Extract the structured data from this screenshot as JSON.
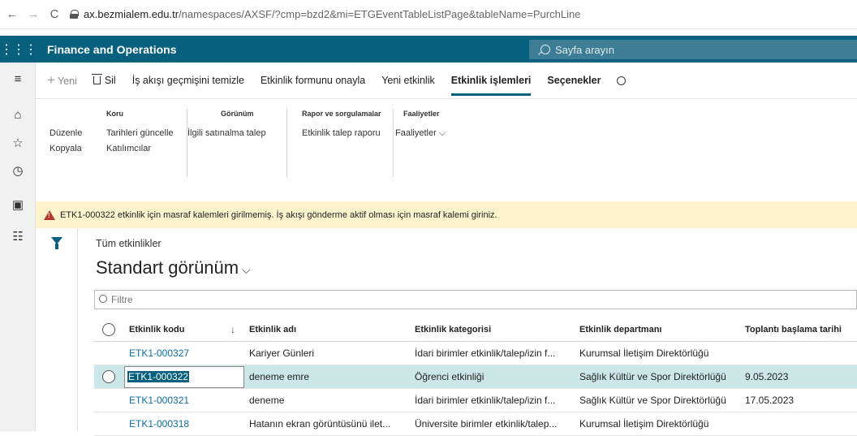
{
  "browser": {
    "back": "←",
    "forward": "→",
    "reload": "C",
    "url_host": "ax.bezmialem.edu.tr",
    "url_path": "/namespaces/AXSF/?cmp=bzd2&mi=ETGEventTableListPage&tableName=PurchLine"
  },
  "app": {
    "waffle": "⋮⋮⋮",
    "title": "Finance and Operations",
    "search_placeholder": "Sayfa arayın"
  },
  "leftnav": {
    "items": [
      "hamburger-icon",
      "home-icon",
      "star-icon",
      "clock-icon",
      "workspace-icon",
      "list-icon"
    ]
  },
  "actions": {
    "new": "Yeni",
    "delete": "Sil",
    "clear_history": "İş akışı geçmişini temizle",
    "confirm_form": "Etkinlik formunu onayla",
    "new_event": "Yeni etkinlik",
    "event_ops": "Etkinlik işlemleri",
    "options": "Seçenekler"
  },
  "ribbon": {
    "edit": "Düzenle",
    "copy": "Kopyala",
    "koru_title": "Koru",
    "update_dates": "Tarihleri güncelle",
    "participants": "Katılımcılar",
    "view_title": "Görünüm",
    "related_purchase": "İlgili satınalma talep",
    "reports_title": "Rapor ve sorgulamalar",
    "event_request_report": "Etkinlik talep raporu",
    "activities_title": "Faaliyetler",
    "activities": "Faaliyetler"
  },
  "warning": {
    "text": "ETK1-000322 etkinlik için masraf kalemleri girilmemiş. İş akışı gönderme aktif olması için masraf kalemi giriniz."
  },
  "list": {
    "crumb": "Tüm etkinlikler",
    "view_title": "Standart görünüm",
    "filter_placeholder": "Filtre",
    "columns": {
      "code": "Etkinlik kodu",
      "name": "Etkinlik adı",
      "category": "Etkinlik kategorisi",
      "department": "Etkinlik departmanı",
      "start_date": "Toplantı başlama tarihi"
    },
    "sort_arrow": "↓",
    "rows": [
      {
        "code": "ETK1-000327",
        "name": "Kariyer Günleri",
        "category": "İdari birimler etkinlik/talep/izin f...",
        "department": "Kurumsal İletişim Direktörlüğü",
        "date": ""
      },
      {
        "code": "ETK1-000322",
        "name": "deneme emre",
        "category": "Öğrenci etkinliği",
        "department": "Sağlık Kültür ve Spor Direktörlüğü",
        "date": "9.05.2023"
      },
      {
        "code": "ETK1-000321",
        "name": "deneme",
        "category": "İdari birimler etkinlik/talep/izin f...",
        "department": "Sağlık Kültür ve Spor Direktörlüğü",
        "date": "17.05.2023"
      },
      {
        "code": "ETK1-000318",
        "name": "Hatanın ekran görüntüsünü ilet...",
        "category": "Üniversite birimler etkinlik/talep...",
        "department": "Kurumsal İletişim Direktörlüğü",
        "date": ""
      }
    ]
  }
}
